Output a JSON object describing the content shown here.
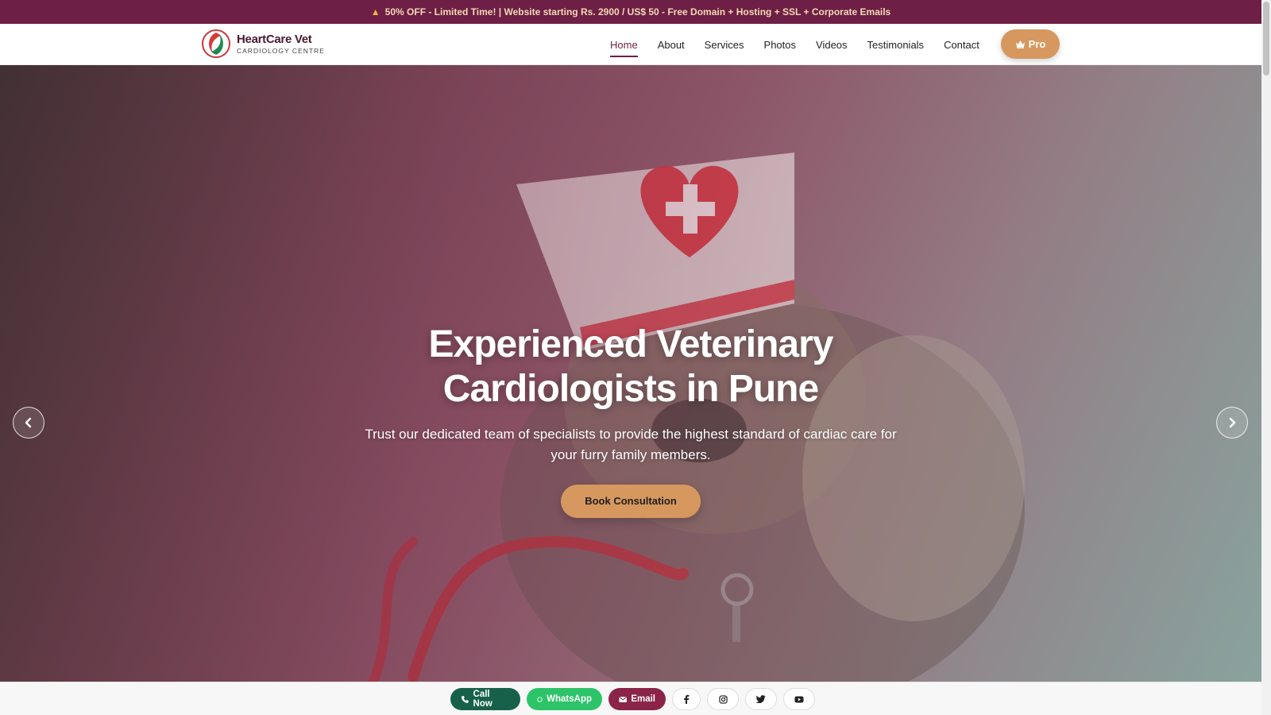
{
  "promo": {
    "icon": "party-popper-icon",
    "text": "50% OFF - Limited Time! | Website starting Rs. 2900 / US$ 50 - Free Domain + Hosting + SSL + Corporate Emails"
  },
  "brand": {
    "name": "HeartCare Vet",
    "tagline": "CARDIOLOGY CENTRE",
    "colors": {
      "primary": "#6e1f45",
      "accent": "#d6985e",
      "logo_red": "#d63a3a",
      "logo_green": "#1f8a50"
    }
  },
  "nav": {
    "items": [
      {
        "label": "Home",
        "active": true
      },
      {
        "label": "About",
        "active": false
      },
      {
        "label": "Services",
        "active": false
      },
      {
        "label": "Photos",
        "active": false
      },
      {
        "label": "Videos",
        "active": false
      },
      {
        "label": "Testimonials",
        "active": false
      },
      {
        "label": "Contact",
        "active": false
      }
    ],
    "pro_label": "Pro",
    "pro_icon": "crown-icon"
  },
  "hero": {
    "title_line1": "Experienced Veterinary",
    "title_line2": "Cardiologists in Pune",
    "subtitle": "Trust our dedicated team of specialists to provide the highest standard of cardiac care for your furry family members.",
    "cta_label": "Book Consultation",
    "prev_icon": "chevron-left-icon",
    "next_icon": "chevron-right-icon"
  },
  "contact_bar": {
    "call_label": "Call Now",
    "whatsapp_label": "WhatsApp",
    "email_label": "Email",
    "socials": [
      "facebook-icon",
      "instagram-icon",
      "twitter-icon",
      "youtube-icon"
    ]
  }
}
